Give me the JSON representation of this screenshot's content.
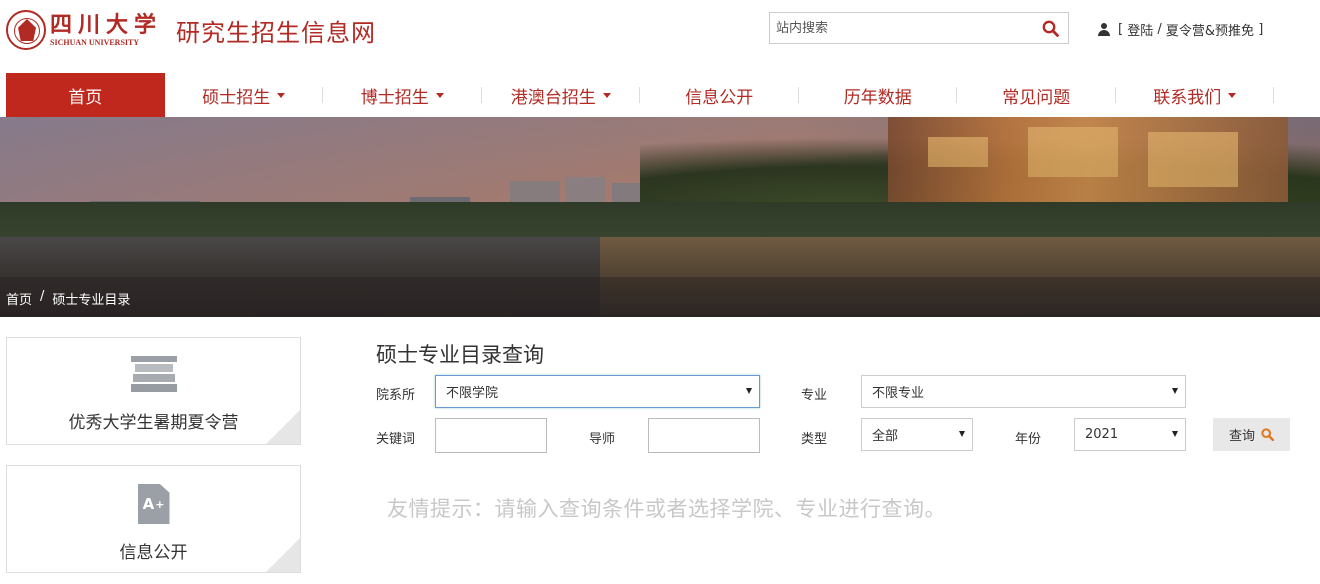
{
  "logo": {
    "cn": "四川大学",
    "en": "SICHUAN UNIVERSITY"
  },
  "site_title": "研究生招生信息网",
  "search": {
    "placeholder": "站内搜索"
  },
  "user": {
    "open": "[",
    "login": "登陆",
    "slash": "/",
    "camp": "夏令营&预推免",
    "close": "]"
  },
  "nav": [
    {
      "label": "首页",
      "active": true,
      "dropdown": false
    },
    {
      "label": "硕士招生",
      "active": false,
      "dropdown": true
    },
    {
      "label": "博士招生",
      "active": false,
      "dropdown": true
    },
    {
      "label": "港澳台招生",
      "active": false,
      "dropdown": true
    },
    {
      "label": "信息公开",
      "active": false,
      "dropdown": false
    },
    {
      "label": "历年数据",
      "active": false,
      "dropdown": false
    },
    {
      "label": "常见问题",
      "active": false,
      "dropdown": false
    },
    {
      "label": "联系我们",
      "active": false,
      "dropdown": true
    }
  ],
  "breadcrumb": {
    "home": "首页",
    "sep": "/",
    "current": "硕士专业目录"
  },
  "sidebar": {
    "card1": "优秀大学生暑期夏令营",
    "card2": "信息公开",
    "doc_icon_text": "A",
    "doc_icon_sup": "+"
  },
  "form": {
    "title": "硕士专业目录查询",
    "dept_label": "院系所",
    "dept_value": "不限学院",
    "major_label": "专业",
    "major_value": "不限专业",
    "keyword_label": "关键词",
    "advisor_label": "导师",
    "type_label": "类型",
    "type_value": "全部",
    "year_label": "年份",
    "year_value": "2021",
    "query_label": "查询"
  },
  "hint": "友情提示：请输入查询条件或者选择学院、专业进行查询。",
  "colors": {
    "brand": "#b22a24",
    "nav_active": "#c0281e",
    "hint": "#c8c8c8"
  }
}
